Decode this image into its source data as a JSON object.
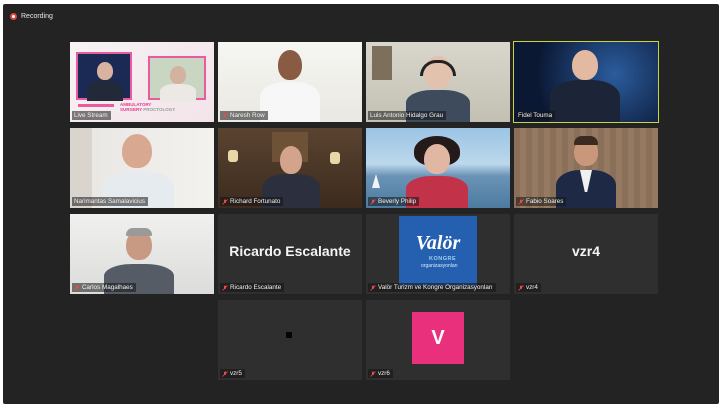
{
  "recording": {
    "label": "Recording"
  },
  "participants": [
    {
      "name": "Live Stream"
    },
    {
      "name": "Naresh Row"
    },
    {
      "name": "Luis Antonio Hidalgo Grau"
    },
    {
      "name": "Fidel Touma"
    },
    {
      "name": "Narimantas Samalavicius"
    },
    {
      "name": "Richard Fortunato"
    },
    {
      "name": "Beverly Philip"
    },
    {
      "name": "Fabio Soares"
    },
    {
      "name": "Carlos Magalhaes"
    },
    {
      "name": "Ricardo Escalante",
      "display": "Ricardo Escalante"
    },
    {
      "name": "Valör Turizm ve Kongre Organizasyonları"
    },
    {
      "name": "vzr4",
      "display": "vzr4"
    },
    {
      "name": "vzr5"
    },
    {
      "name": "vzr6",
      "avatar_letter": "V"
    }
  ],
  "slide": {
    "line1": "AMBULATORY",
    "line2": "SURGERY",
    "line3": "PROCTOLOGY"
  },
  "valor_logo": {
    "brand": "Valör",
    "sub1": "KONGRE",
    "sub2": "organizasyonları"
  },
  "colors": {
    "active_border": "#c8d63c",
    "avatar_pink": "#e9307d",
    "logo_blue": "#2560b0"
  }
}
